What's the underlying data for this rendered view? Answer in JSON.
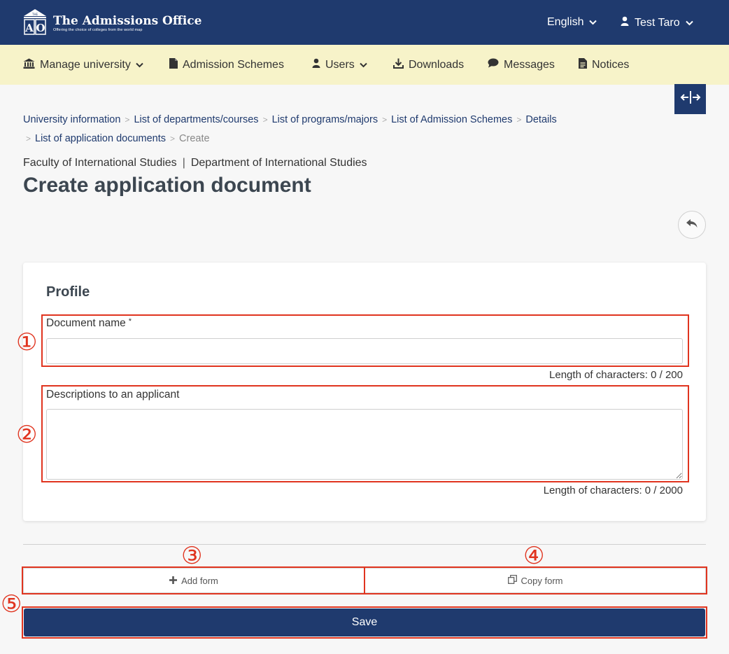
{
  "header": {
    "logo_letters": "AO",
    "logo_small": "THE",
    "title": "The Admissions Office",
    "tagline": "Offering the choice of colleges from the world map",
    "language": "English",
    "user": "Test Taro"
  },
  "nav": {
    "items": [
      {
        "label": "Manage university",
        "icon": "university-icon",
        "dropdown": true
      },
      {
        "label": "Admission Schemes",
        "icon": "document-icon",
        "dropdown": false
      },
      {
        "label": "Users",
        "icon": "user-icon",
        "dropdown": true
      },
      {
        "label": "Downloads",
        "icon": "download-icon",
        "dropdown": false
      },
      {
        "label": "Messages",
        "icon": "chat-icon",
        "dropdown": false
      },
      {
        "label": "Notices",
        "icon": "notice-icon",
        "dropdown": false
      }
    ]
  },
  "breadcrumb": {
    "items": [
      "University information",
      "List of departments/courses",
      "List of programs/majors",
      "List of Admission Schemes",
      "Details",
      "List of application documents"
    ],
    "current": "Create"
  },
  "context": {
    "faculty": "Faculty of International Studies",
    "separator": "|",
    "department": "Department of International Studies"
  },
  "page": {
    "title": "Create application document"
  },
  "form": {
    "section_title": "Profile",
    "document_name": {
      "label": "Document name",
      "required_mark": "*",
      "value": "",
      "counter": "Length of characters: 0  /  200"
    },
    "description": {
      "label": "Descriptions to an applicant",
      "value": "",
      "counter": "Length of characters: 0  /  2000"
    }
  },
  "actions": {
    "add_form": "Add form",
    "copy_form": "Copy form",
    "save": "Save"
  },
  "annotations": {
    "markers": [
      "①",
      "②",
      "③",
      "④",
      "⑤"
    ],
    "color": "#e0341f"
  },
  "colors": {
    "primary": "#1f3a6e",
    "nav_background": "#f7f3c9",
    "page_background": "#f7f7f7"
  }
}
